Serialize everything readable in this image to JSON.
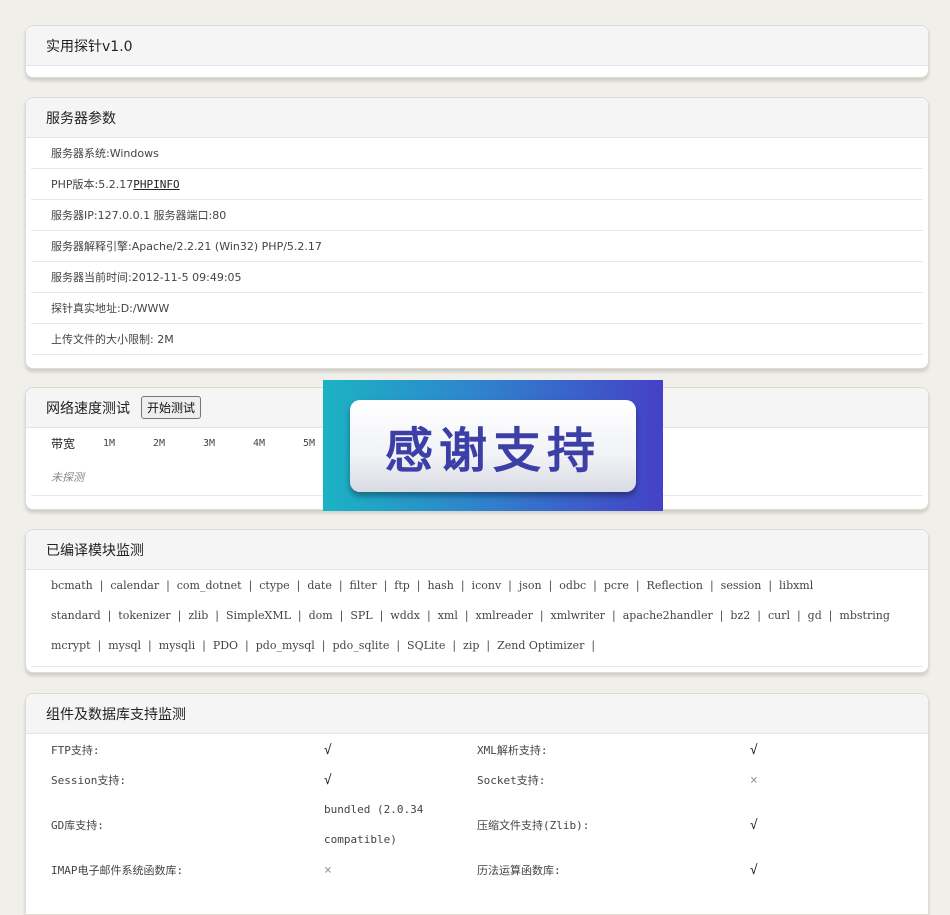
{
  "header": {
    "title": "实用探针v1.0"
  },
  "server": {
    "title": "服务器参数",
    "rows": [
      {
        "text": "服务器系统:Windows"
      },
      {
        "text": "PHP版本:5.2.17",
        "link": "PHPINFO"
      },
      {
        "text": "服务器IP:127.0.0.1  服务器端口:80"
      },
      {
        "text": "服务器解释引擎:Apache/2.2.21 (Win32) PHP/5.2.17"
      },
      {
        "text": "服务器当前时间:2012-11-5 09:49:05"
      },
      {
        "text": "探针真实地址:D:/WWW"
      },
      {
        "text": "上传文件的大小限制: 2M"
      }
    ]
  },
  "speed": {
    "title": "网络速度测试",
    "button": "开始测试",
    "bandwidth_label": "带宽",
    "ticks": [
      "1M",
      "2M",
      "3M",
      "4M",
      "5M"
    ],
    "status": "未探测"
  },
  "overlay": {
    "text": "感谢支持"
  },
  "modules": {
    "title": "已编译模块监测",
    "lines": [
      "bcmath  |  calendar  |  com_dotnet  |  ctype  |  date  |  filter  |  ftp  |  hash  |  iconv  |  json  |  odbc  |  pcre  |  Reflection  |  session  |  libxml",
      "standard  |  tokenizer  |  zlib  |  SimpleXML  |  dom  |  SPL  |  wddx  |  xml  |  xmlreader  |  xmlwriter  |  apache2handler  |  bz2  |  curl  |  gd  |  mbstring",
      "mcrypt  |  mysql  |  mysqli  |  PDO  |  pdo_mysql  |  pdo_sqlite  |  SQLite  |  zip  |  Zend Optimizer  |"
    ]
  },
  "components": {
    "title": "组件及数据库支持监测",
    "rows": [
      {
        "l1": "FTP支持:",
        "v1": "√",
        "l2": "XML解析支持:",
        "v2": "√"
      },
      {
        "l1": "Session支持:",
        "v1": "√",
        "l2": "Socket支持:",
        "v2": "×"
      },
      {
        "l1": "GD库支持:",
        "v1": "bundled (2.0.34 compatible)",
        "l2": "压缩文件支持(Zlib):",
        "v2": "√"
      },
      {
        "l1": "IMAP电子邮件系统函数库:",
        "v1": "×",
        "l2": "历法运算函数库:",
        "v2": "√"
      }
    ]
  }
}
